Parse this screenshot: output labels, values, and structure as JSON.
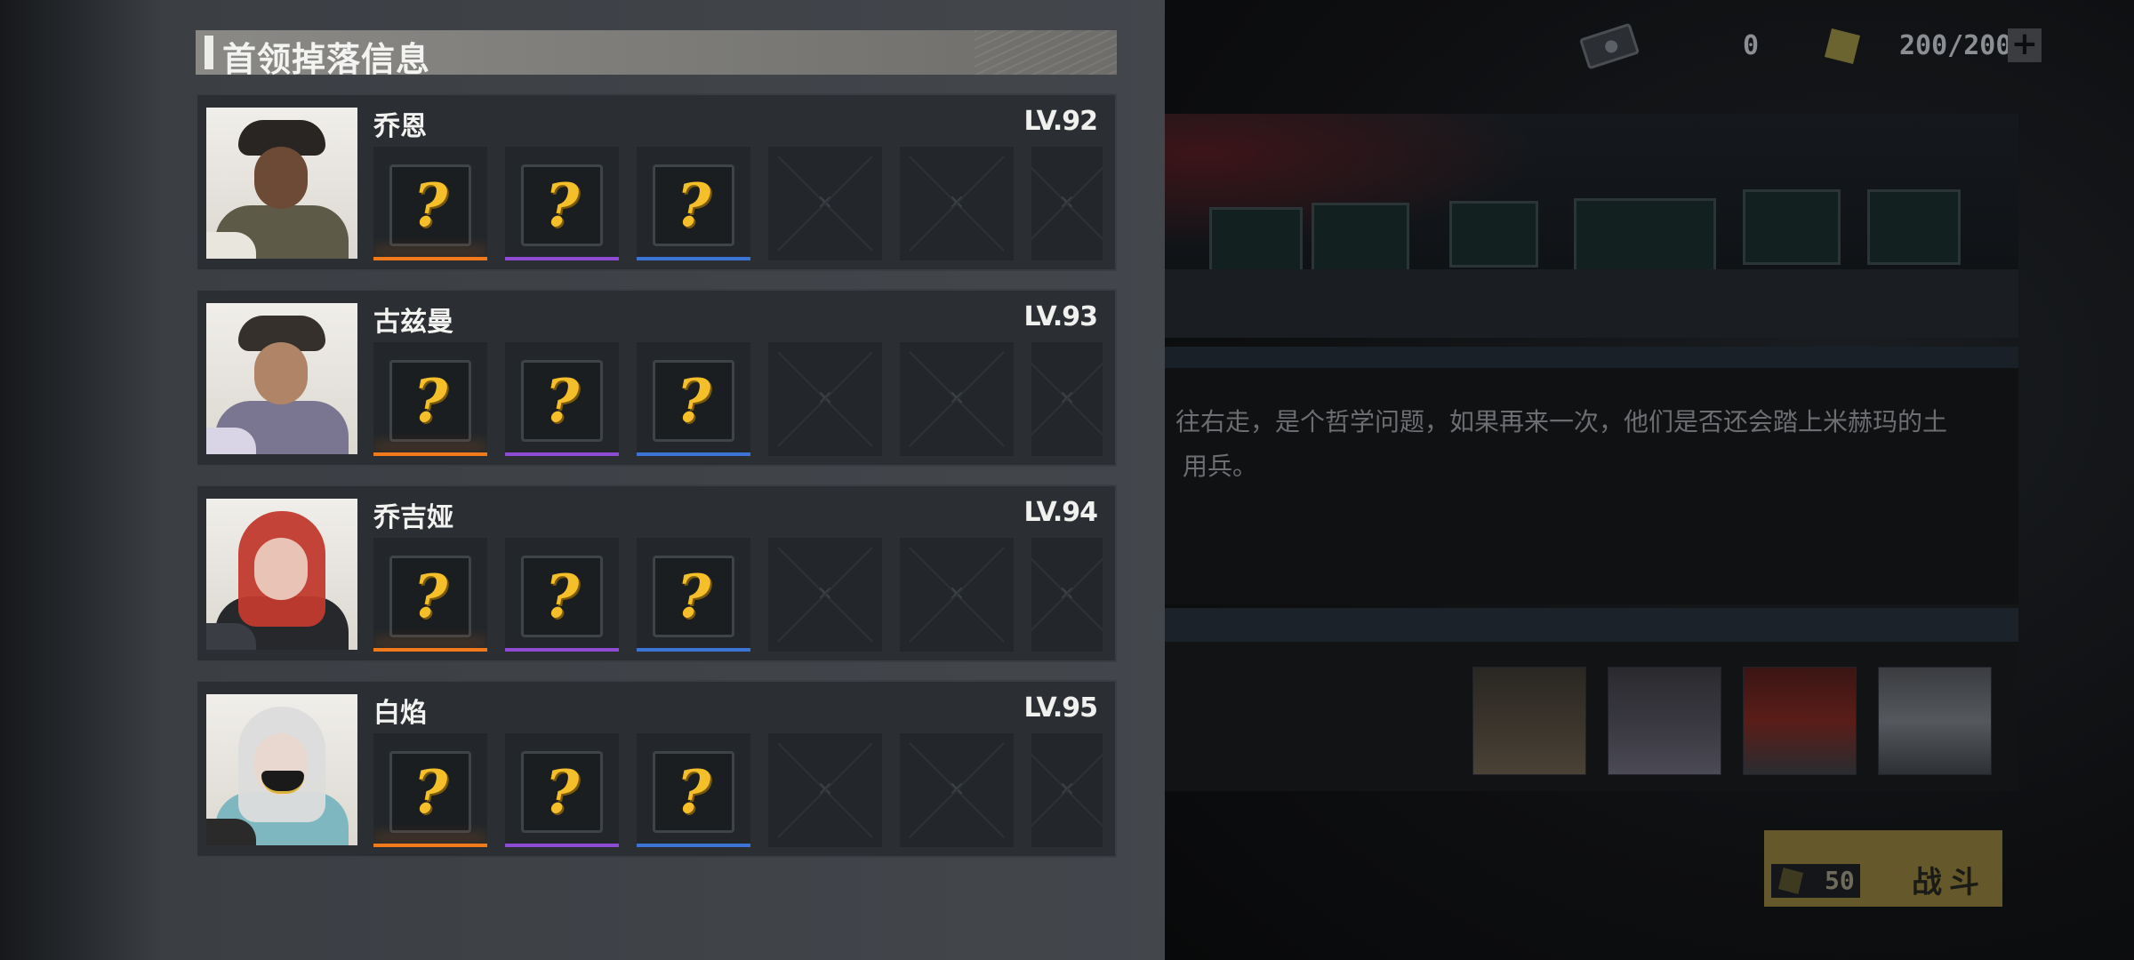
{
  "topbar": {
    "ticket_icon": "ticket-icon",
    "ticket_count": "0",
    "stamina_icon": "battery-icon",
    "stamina_value": "200/200",
    "add_label": "+"
  },
  "story": {
    "text_line1": "往右走，是个哲学问题，如果再来一次，他们是否还会踏上米赫玛的土",
    "text_line2": "用兵。"
  },
  "fight": {
    "cost": "50",
    "label": "战斗"
  },
  "modal": {
    "title": "首领掉落信息",
    "bosses": [
      {
        "name": "乔恩",
        "level": "LV.92"
      },
      {
        "name": "古兹曼",
        "level": "LV.93"
      },
      {
        "name": "乔吉娅",
        "level": "LV.94"
      },
      {
        "name": "白焰",
        "level": "LV.95"
      }
    ],
    "slot_rarities": [
      "orange",
      "purple",
      "blue"
    ],
    "mystery_glyph": "?",
    "empty_glyph": "×"
  },
  "colors": {
    "accent_yellow": "#f4bf28",
    "rarity_orange": "#f27a1a",
    "rarity_purple": "#8f4bd4",
    "rarity_blue": "#3b74d6"
  }
}
